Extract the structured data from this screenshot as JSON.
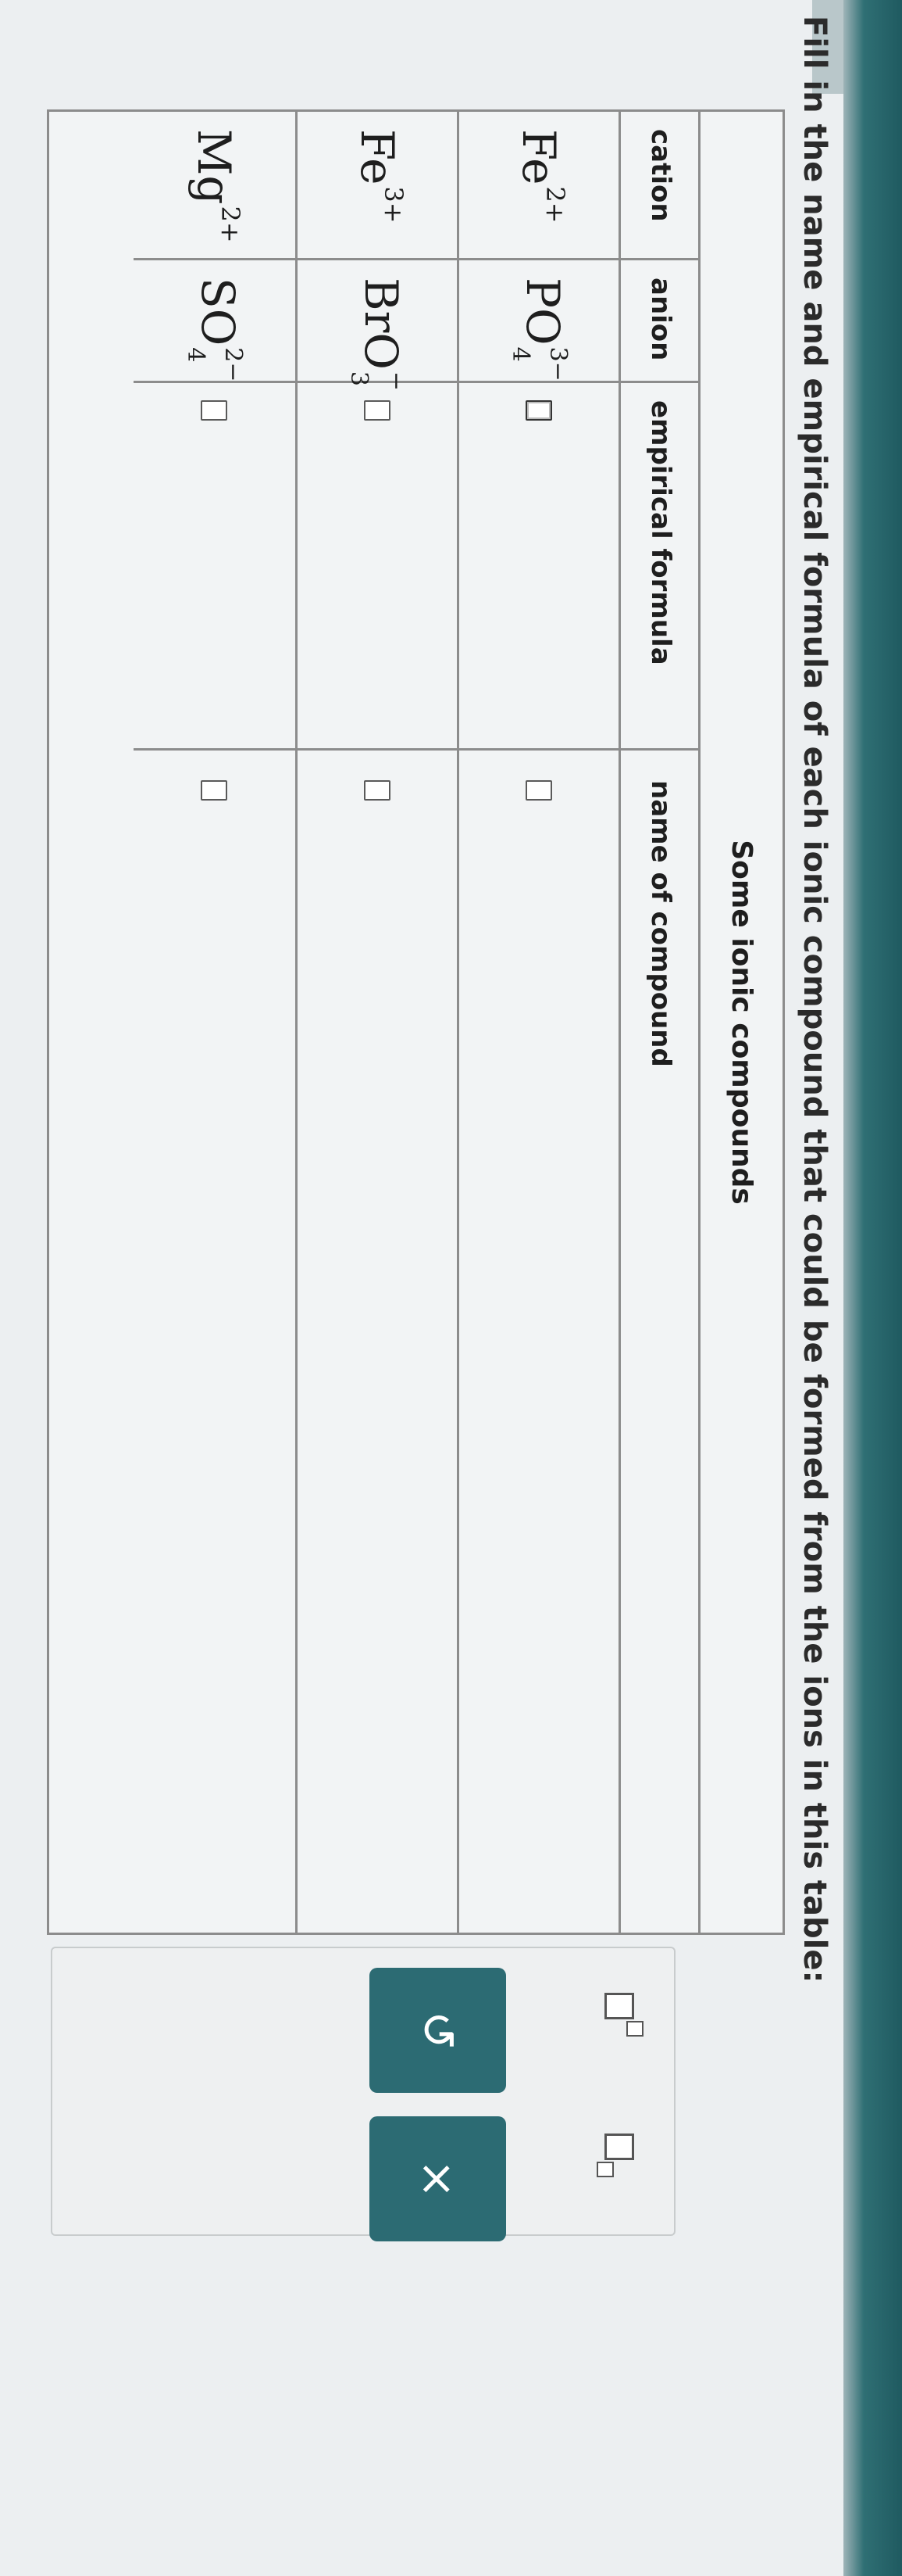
{
  "instruction": "Fill in the name and empirical formula of each ionic compound that could be formed from the ions in this table:",
  "table": {
    "title": "Some ionic compounds",
    "headers": [
      "cation",
      "anion",
      "empirical formula",
      "name of compound"
    ],
    "rows": [
      {
        "cation": {
          "base": "Fe",
          "charge": "2+"
        },
        "anion": {
          "base": "PO",
          "sub": "4",
          "charge": "3−"
        },
        "empirical_formula": "",
        "name_of_compound": ""
      },
      {
        "cation": {
          "base": "Fe",
          "charge": "3+"
        },
        "anion": {
          "base": "BrO",
          "sub": "3",
          "charge": "−"
        },
        "empirical_formula": "",
        "name_of_compound": ""
      },
      {
        "cation": {
          "base": "Mg",
          "charge": "2+"
        },
        "anion": {
          "base": "SO",
          "sub": "4",
          "charge": "2−"
        },
        "empirical_formula": "",
        "name_of_compound": ""
      }
    ]
  },
  "toolbar": {
    "superscript_icon": "superscript-box-icon",
    "subscript_icon": "subscript-box-icon",
    "undo_label": "↺",
    "clear_label": "×"
  },
  "colors": {
    "button_bg": "#2c6b73",
    "button_fg": "#ffffff",
    "border": "#8c8c8c"
  }
}
